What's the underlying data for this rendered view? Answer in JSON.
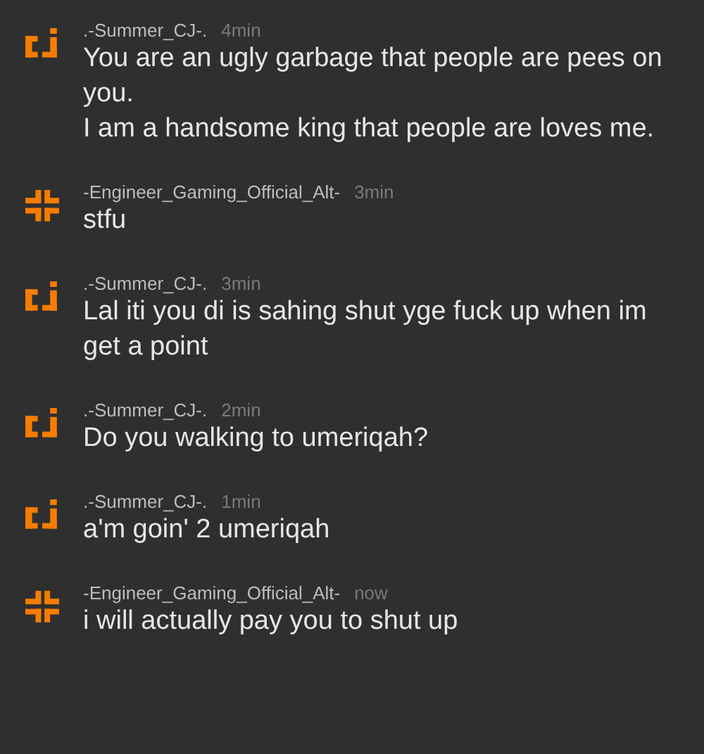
{
  "messages": [
    {
      "kind": "bracket",
      "user": ".-Summer_CJ-.",
      "time": "4min",
      "paragraphs": [
        "You are an ugly garbage that people are pees on you.",
        "I am a handsome king that people are loves me."
      ]
    },
    {
      "kind": "cross",
      "user": "-Engineer_Gaming_Official_Alt-",
      "time": "3min",
      "paragraphs": [
        "stfu"
      ]
    },
    {
      "kind": "bracket",
      "user": ".-Summer_CJ-.",
      "time": "3min",
      "paragraphs": [
        "Lal iti you di is sahing shut yge fuck up when im get a point"
      ]
    },
    {
      "kind": "bracket",
      "user": ".-Summer_CJ-.",
      "time": "2min",
      "paragraphs": [
        "Do you walking to umeriqah?"
      ]
    },
    {
      "kind": "bracket",
      "user": ".-Summer_CJ-.",
      "time": "1min",
      "paragraphs": [
        "a'm goin' 2 umeriqah"
      ]
    },
    {
      "kind": "cross",
      "user": "-Engineer_Gaming_Official_Alt-",
      "time": "now",
      "paragraphs": [
        "i will actually pay you to shut up"
      ]
    }
  ]
}
